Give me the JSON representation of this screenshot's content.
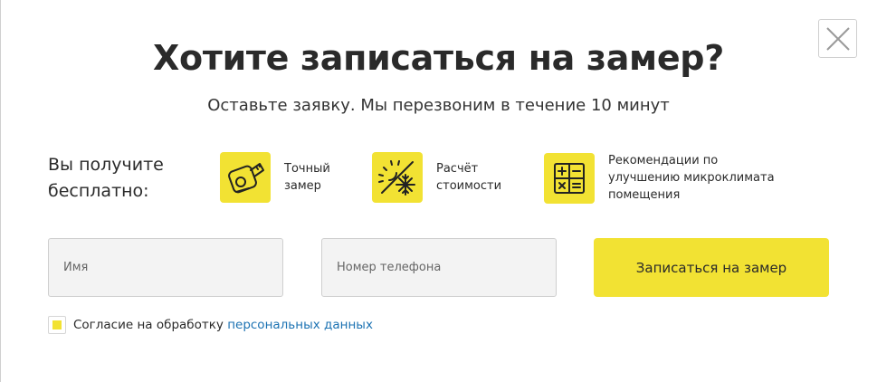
{
  "modal": {
    "title": "Хотите записаться на замер?",
    "subtitle": "Оставьте заявку. Мы перезвоним в течение 10 минут",
    "close_icon": "close-icon"
  },
  "benefits": {
    "label": "Вы получите бесплатно:",
    "items": [
      {
        "icon": "tape-measure-icon",
        "text": "Точный\nзамер"
      },
      {
        "icon": "sun-snowflake-icon",
        "text": "Расчёт\nстоимости"
      },
      {
        "icon": "calculator-icon",
        "text": "Рекомендации по\n улучшению микроклимата\nпомещения"
      }
    ]
  },
  "form": {
    "name_placeholder": "Имя",
    "phone_placeholder": "Номер телефона",
    "name_value": "",
    "phone_value": "",
    "submit_label": "Записаться на замер"
  },
  "consent": {
    "checked": true,
    "text": "Согласие на обработку ",
    "link_text": "персональных данных"
  },
  "colors": {
    "accent": "#f2e233",
    "link": "#1d73b3",
    "input_bg": "#f3f3f3"
  }
}
